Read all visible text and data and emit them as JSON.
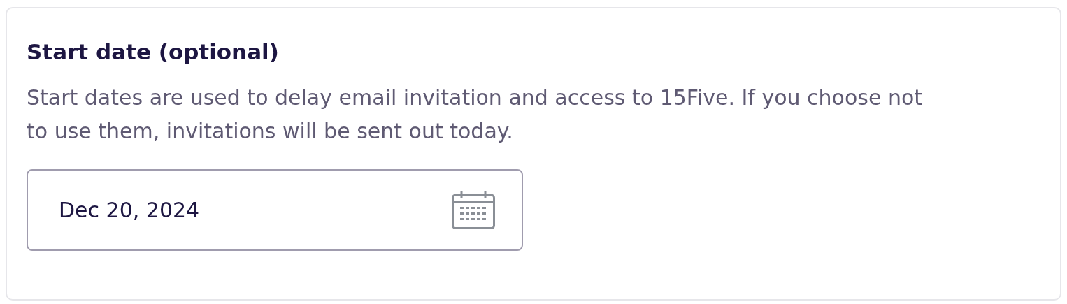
{
  "card": {
    "title": "Start date (optional)",
    "description": "Start dates are used to delay email invitation and access to 15Five. If you choose not to use them, invitations will be sent out today.",
    "date_field": {
      "value": "Dec 20, 2024"
    }
  }
}
